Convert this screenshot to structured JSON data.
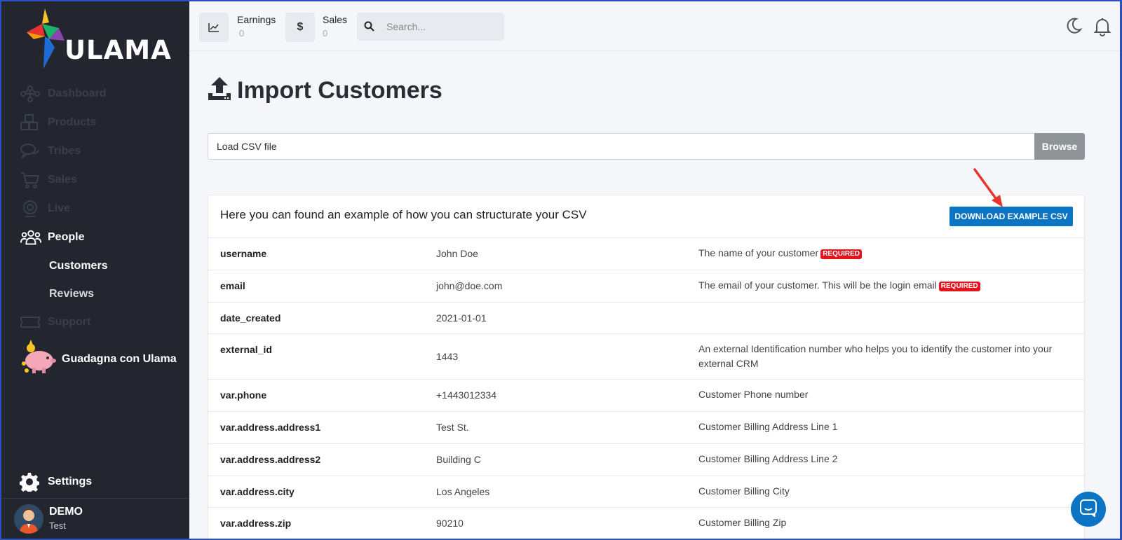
{
  "brand": {
    "name": "ULAMA"
  },
  "sidebar": {
    "items": [
      {
        "label": "Dashboard",
        "icon": "nodes-icon"
      },
      {
        "label": "Products",
        "icon": "boxes-icon"
      },
      {
        "label": "Tribes",
        "icon": "chat-icon"
      },
      {
        "label": "Sales",
        "icon": "cart-icon"
      },
      {
        "label": "Live",
        "icon": "webcam-icon"
      },
      {
        "label": "People",
        "icon": "users-icon",
        "active": true
      }
    ],
    "subitems": [
      {
        "label": "Customers",
        "current": true
      },
      {
        "label": "Reviews"
      }
    ],
    "support": {
      "label": "Support",
      "icon": "ticket-icon"
    },
    "promo": {
      "label": "Guadagna con Ulama",
      "icon": "piggy-bank-icon"
    },
    "settings": {
      "label": "Settings",
      "icon": "gear-icon"
    },
    "user": {
      "name": "DEMO",
      "sub": "Test"
    }
  },
  "topbar": {
    "earnings": {
      "label": "Earnings",
      "value": "0"
    },
    "sales": {
      "label": "Sales",
      "value": "0",
      "icon_symbol": "$"
    },
    "search": {
      "placeholder": "Search..."
    }
  },
  "page": {
    "title": "Import Customers",
    "file_input": {
      "label": "Load CSV file",
      "button": "Browse"
    },
    "card": {
      "title": "Here you can found an example of how you can structurate your CSV",
      "button": "DOWNLOAD EXAMPLE CSV",
      "required_label": "REQUIRED",
      "rows": [
        {
          "field": "username",
          "example": "John Doe",
          "description": "The name of your customer",
          "required": true
        },
        {
          "field": "email",
          "example": "john@doe.com",
          "description": "The email of your customer. This will be the login email",
          "required": true
        },
        {
          "field": "date_created",
          "example": "2021-01-01",
          "description": ""
        },
        {
          "field": "external_id",
          "example": "1443",
          "description": "An external Identification number who helps you to identify the customer into your external CRM"
        },
        {
          "field": "var.phone",
          "example": "+1443012334",
          "description": "Customer Phone number"
        },
        {
          "field": "var.address.address1",
          "example": "Test St.",
          "description": "Customer Billing Address Line 1"
        },
        {
          "field": "var.address.address2",
          "example": "Building C",
          "description": "Customer Billing Address Line 2"
        },
        {
          "field": "var.address.city",
          "example": "Los Angeles",
          "description": "Customer Billing City"
        },
        {
          "field": "var.address.zip",
          "example": "90210",
          "description": "Customer Billing Zip"
        }
      ]
    }
  },
  "colors": {
    "accent": "#0c74c4",
    "required": "#e3141c",
    "sidebar": "#23252f",
    "annotation": "#e8332e"
  }
}
